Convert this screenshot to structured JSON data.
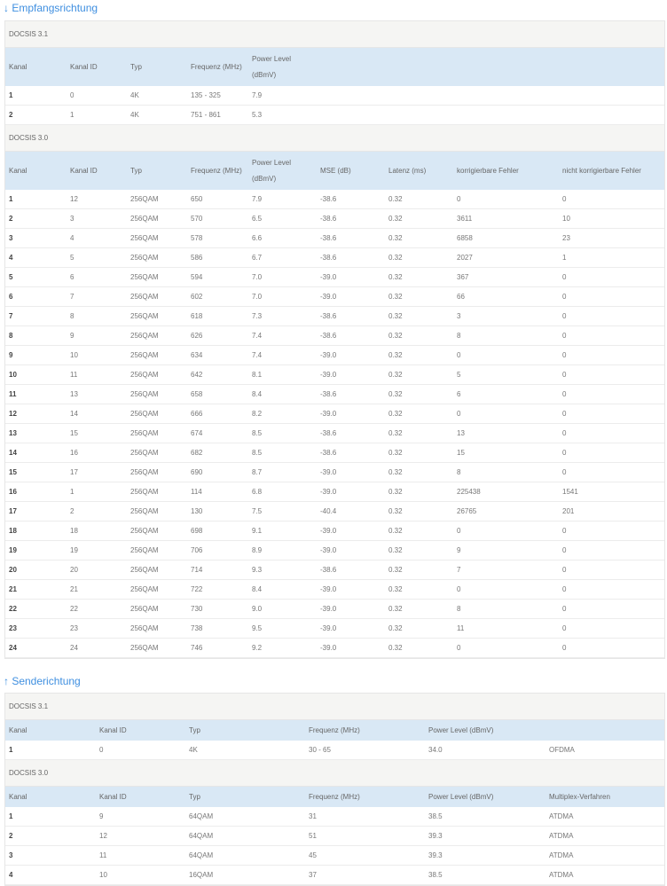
{
  "downstream": {
    "title": "↓ Empfangsrichtung",
    "docsis31": {
      "label": "DOCSIS 3.1",
      "headers": [
        "Kanal",
        "Kanal ID",
        "Typ",
        "Frequenz (MHz)",
        "Power Level (dBmV)"
      ],
      "rows": [
        [
          "1",
          "0",
          "4K",
          "135 - 325",
          "7.9"
        ],
        [
          "2",
          "1",
          "4K",
          "751 - 861",
          "5.3"
        ]
      ]
    },
    "docsis30": {
      "label": "DOCSIS 3.0",
      "headers": [
        "Kanal",
        "Kanal ID",
        "Typ",
        "Frequenz (MHz)",
        "Power Level (dBmV)",
        "MSE (dB)",
        "Latenz (ms)",
        "korrigierbare Fehler",
        "nicht korrigierbare Fehler"
      ],
      "rows": [
        [
          "1",
          "12",
          "256QAM",
          "650",
          "7.9",
          "-38.6",
          "0.32",
          "0",
          "0"
        ],
        [
          "2",
          "3",
          "256QAM",
          "570",
          "6.5",
          "-38.6",
          "0.32",
          "3611",
          "10"
        ],
        [
          "3",
          "4",
          "256QAM",
          "578",
          "6.6",
          "-38.6",
          "0.32",
          "6858",
          "23"
        ],
        [
          "4",
          "5",
          "256QAM",
          "586",
          "6.7",
          "-38.6",
          "0.32",
          "2027",
          "1"
        ],
        [
          "5",
          "6",
          "256QAM",
          "594",
          "7.0",
          "-39.0",
          "0.32",
          "367",
          "0"
        ],
        [
          "6",
          "7",
          "256QAM",
          "602",
          "7.0",
          "-39.0",
          "0.32",
          "66",
          "0"
        ],
        [
          "7",
          "8",
          "256QAM",
          "618",
          "7.3",
          "-38.6",
          "0.32",
          "3",
          "0"
        ],
        [
          "8",
          "9",
          "256QAM",
          "626",
          "7.4",
          "-38.6",
          "0.32",
          "8",
          "0"
        ],
        [
          "9",
          "10",
          "256QAM",
          "634",
          "7.4",
          "-39.0",
          "0.32",
          "0",
          "0"
        ],
        [
          "10",
          "11",
          "256QAM",
          "642",
          "8.1",
          "-39.0",
          "0.32",
          "5",
          "0"
        ],
        [
          "11",
          "13",
          "256QAM",
          "658",
          "8.4",
          "-38.6",
          "0.32",
          "6",
          "0"
        ],
        [
          "12",
          "14",
          "256QAM",
          "666",
          "8.2",
          "-39.0",
          "0.32",
          "0",
          "0"
        ],
        [
          "13",
          "15",
          "256QAM",
          "674",
          "8.5",
          "-38.6",
          "0.32",
          "13",
          "0"
        ],
        [
          "14",
          "16",
          "256QAM",
          "682",
          "8.5",
          "-38.6",
          "0.32",
          "15",
          "0"
        ],
        [
          "15",
          "17",
          "256QAM",
          "690",
          "8.7",
          "-39.0",
          "0.32",
          "8",
          "0"
        ],
        [
          "16",
          "1",
          "256QAM",
          "114",
          "6.8",
          "-39.0",
          "0.32",
          "225438",
          "1541"
        ],
        [
          "17",
          "2",
          "256QAM",
          "130",
          "7.5",
          "-40.4",
          "0.32",
          "26765",
          "201"
        ],
        [
          "18",
          "18",
          "256QAM",
          "698",
          "9.1",
          "-39.0",
          "0.32",
          "0",
          "0"
        ],
        [
          "19",
          "19",
          "256QAM",
          "706",
          "8.9",
          "-39.0",
          "0.32",
          "9",
          "0"
        ],
        [
          "20",
          "20",
          "256QAM",
          "714",
          "9.3",
          "-38.6",
          "0.32",
          "7",
          "0"
        ],
        [
          "21",
          "21",
          "256QAM",
          "722",
          "8.4",
          "-39.0",
          "0.32",
          "0",
          "0"
        ],
        [
          "22",
          "22",
          "256QAM",
          "730",
          "9.0",
          "-39.0",
          "0.32",
          "8",
          "0"
        ],
        [
          "23",
          "23",
          "256QAM",
          "738",
          "9.5",
          "-39.0",
          "0.32",
          "11",
          "0"
        ],
        [
          "24",
          "24",
          "256QAM",
          "746",
          "9.2",
          "-39.0",
          "0.32",
          "0",
          "0"
        ]
      ]
    }
  },
  "upstream": {
    "title": "↑ Senderichtung",
    "docsis31": {
      "label": "DOCSIS 3.1",
      "headers": [
        "Kanal",
        "Kanal ID",
        "Typ",
        "Frequenz (MHz)",
        "Power Level (dBmV)",
        ""
      ],
      "rows": [
        [
          "1",
          "0",
          "4K",
          "30 - 65",
          "34.0",
          "OFDMA"
        ]
      ]
    },
    "docsis30": {
      "label": "DOCSIS 3.0",
      "headers": [
        "Kanal",
        "Kanal ID",
        "Typ",
        "Frequenz (MHz)",
        "Power Level (dBmV)",
        "Multiplex-Verfahren"
      ],
      "rows": [
        [
          "1",
          "9",
          "64QAM",
          "31",
          "38.5",
          "ATDMA"
        ],
        [
          "2",
          "12",
          "64QAM",
          "51",
          "39.3",
          "ATDMA"
        ],
        [
          "3",
          "11",
          "64QAM",
          "45",
          "39.3",
          "ATDMA"
        ],
        [
          "4",
          "10",
          "16QAM",
          "37",
          "38.5",
          "ATDMA"
        ]
      ]
    }
  }
}
